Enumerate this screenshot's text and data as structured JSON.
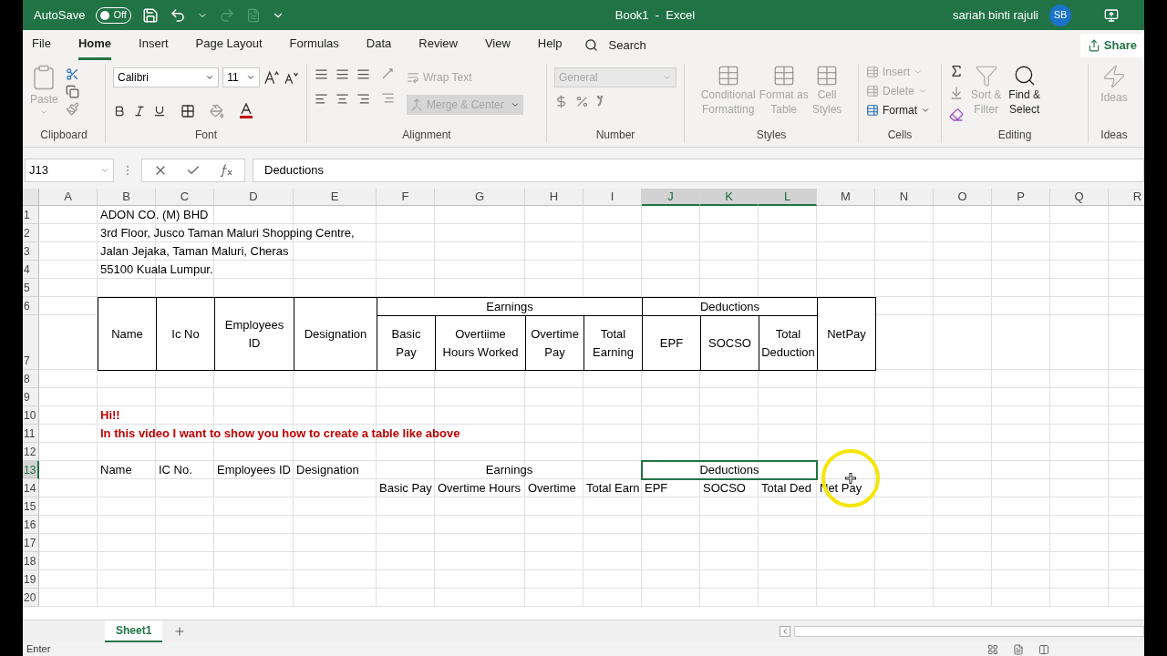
{
  "title_bar": {
    "autosave_label": "AutoSave",
    "autosave_state": "Off",
    "autosave_on": false,
    "title": "Book1  -  Excel",
    "user": "sariah binti rajuli",
    "avatar": "SB"
  },
  "menu_tabs": [
    {
      "label": "File",
      "selected": false
    },
    {
      "label": "Home",
      "selected": true
    },
    {
      "label": "Insert",
      "selected": false
    },
    {
      "label": "Page Layout",
      "selected": false
    },
    {
      "label": "Formulas",
      "selected": false
    },
    {
      "label": "Data",
      "selected": false
    },
    {
      "label": "Review",
      "selected": false
    },
    {
      "label": "View",
      "selected": false
    },
    {
      "label": "Help",
      "selected": false
    }
  ],
  "search": {
    "label": "Search"
  },
  "share": {
    "label": "Share"
  },
  "ribbon": {
    "clipboard": {
      "label": "Clipboard",
      "paste": "Paste",
      "paste_disabled": true
    },
    "font": {
      "label": "Font",
      "name": "Calibri",
      "size": "11"
    },
    "alignment": {
      "label": "Alignment",
      "wrap": "Wrap Text",
      "merge": "Merge & Center",
      "disabled": true
    },
    "number": {
      "label": "Number",
      "format": "General",
      "disabled": true
    },
    "styles": {
      "label": "Styles",
      "items": [
        {
          "lines": [
            "Conditional",
            "Formatting"
          ],
          "disabled": true
        },
        {
          "lines": [
            "Format as",
            "Table"
          ],
          "disabled": true
        },
        {
          "lines": [
            "Cell",
            "Styles"
          ],
          "disabled": true
        }
      ]
    },
    "cells": {
      "label": "Cells",
      "items": [
        {
          "label": "Insert",
          "disabled": true
        },
        {
          "label": "Delete",
          "disabled": true
        },
        {
          "label": "Format",
          "disabled": false
        }
      ]
    },
    "editing": {
      "label": "Editing",
      "sort": {
        "lines": [
          "Sort &",
          "Filter"
        ],
        "disabled": true
      },
      "find": {
        "lines": [
          "Find &",
          "Select"
        ],
        "disabled": false
      }
    },
    "ideas": {
      "label": "Ideas",
      "button": "Ideas",
      "disabled": true
    }
  },
  "formula_bar": {
    "name_box": "J13",
    "value": "Deductions"
  },
  "sheet": {
    "columns": [
      {
        "label": "A",
        "selected": false
      },
      {
        "label": "B",
        "selected": false
      },
      {
        "label": "C",
        "selected": false
      },
      {
        "label": "D",
        "selected": false
      },
      {
        "label": "E",
        "selected": false
      },
      {
        "label": "F",
        "selected": false
      },
      {
        "label": "G",
        "selected": false
      },
      {
        "label": "H",
        "selected": false
      },
      {
        "label": "I",
        "selected": false
      },
      {
        "label": "J",
        "selected": true
      },
      {
        "label": "K",
        "selected": true
      },
      {
        "label": "L",
        "selected": true
      },
      {
        "label": "M",
        "selected": false
      },
      {
        "label": "N",
        "selected": false
      },
      {
        "label": "O",
        "selected": false
      },
      {
        "label": "P",
        "selected": false
      },
      {
        "label": "Q",
        "selected": false
      },
      {
        "label": "R",
        "selected": false
      }
    ],
    "rows": [
      {
        "label": "1",
        "selected": false,
        "kind": "plain",
        "cells": [
          "",
          "ADON CO. (M) BHD"
        ]
      },
      {
        "label": "2",
        "selected": false,
        "kind": "plain",
        "cells": [
          "",
          "3rd Floor, Jusco Taman Maluri Shopping Centre,"
        ]
      },
      {
        "label": "3",
        "selected": false,
        "kind": "plain",
        "cells": [
          "",
          "Jalan Jejaka, Taman Maluri, Cheras"
        ]
      },
      {
        "label": "4",
        "selected": false,
        "kind": "plain",
        "cells": [
          "",
          "55100 Kuala Lumpur."
        ]
      },
      {
        "label": "5",
        "selected": false,
        "kind": "plain",
        "cells": []
      },
      {
        "label": "6",
        "selected": false,
        "kind": "boxed_top",
        "cells": [
          "",
          "Name",
          "Ic No",
          "Employees ID",
          "Designation",
          "Earnings",
          "",
          "",
          "",
          "Deductions",
          "",
          "",
          "NetPay"
        ]
      },
      {
        "label": "7",
        "selected": false,
        "kind": "boxed_sub",
        "cells": [
          "",
          "",
          "",
          "",
          "",
          "Basic Pay",
          "Overtiime Hours Worked",
          "Overtime Pay",
          "Total Earning",
          "EPF",
          "SOCSO",
          "Total Deduction"
        ]
      },
      {
        "label": "8",
        "selected": false,
        "kind": "plain",
        "cells": []
      },
      {
        "label": "9",
        "selected": false,
        "kind": "plain",
        "cells": []
      },
      {
        "label": "10",
        "selected": false,
        "kind": "note",
        "cells": [
          "",
          "Hi!!"
        ]
      },
      {
        "label": "11",
        "selected": false,
        "kind": "note",
        "cells": [
          "",
          "In this video I want to show you how to create a table like above"
        ]
      },
      {
        "label": "12",
        "selected": false,
        "kind": "plain",
        "cells": []
      },
      {
        "label": "13",
        "selected": true,
        "kind": "plain",
        "cells": [
          "",
          "Name",
          "IC No.",
          "Employees ID",
          "Designation",
          "Earnings",
          "",
          "",
          "",
          "Deductions"
        ]
      },
      {
        "label": "14",
        "selected": false,
        "kind": "plain",
        "cells": [
          "",
          "",
          "",
          "",
          "",
          "Basic Pay",
          "Overtime Hours",
          "Overtime",
          "Total Earn",
          "EPF",
          "SOCSO",
          "Total Ded",
          "Net Pay"
        ]
      },
      {
        "label": "15",
        "selected": false,
        "kind": "plain",
        "cells": []
      },
      {
        "label": "16",
        "selected": false,
        "kind": "plain",
        "cells": []
      },
      {
        "label": "17",
        "selected": false,
        "kind": "plain",
        "cells": []
      },
      {
        "label": "18",
        "selected": false,
        "kind": "plain",
        "cells": []
      },
      {
        "label": "19",
        "selected": false,
        "kind": "plain",
        "cells": []
      },
      {
        "label": "20",
        "selected": false,
        "kind": "plain",
        "cells": []
      }
    ]
  },
  "sheet_tabs": [
    {
      "label": "Sheet1",
      "selected": true
    }
  ],
  "status_bar": {
    "mode": "Enter"
  }
}
